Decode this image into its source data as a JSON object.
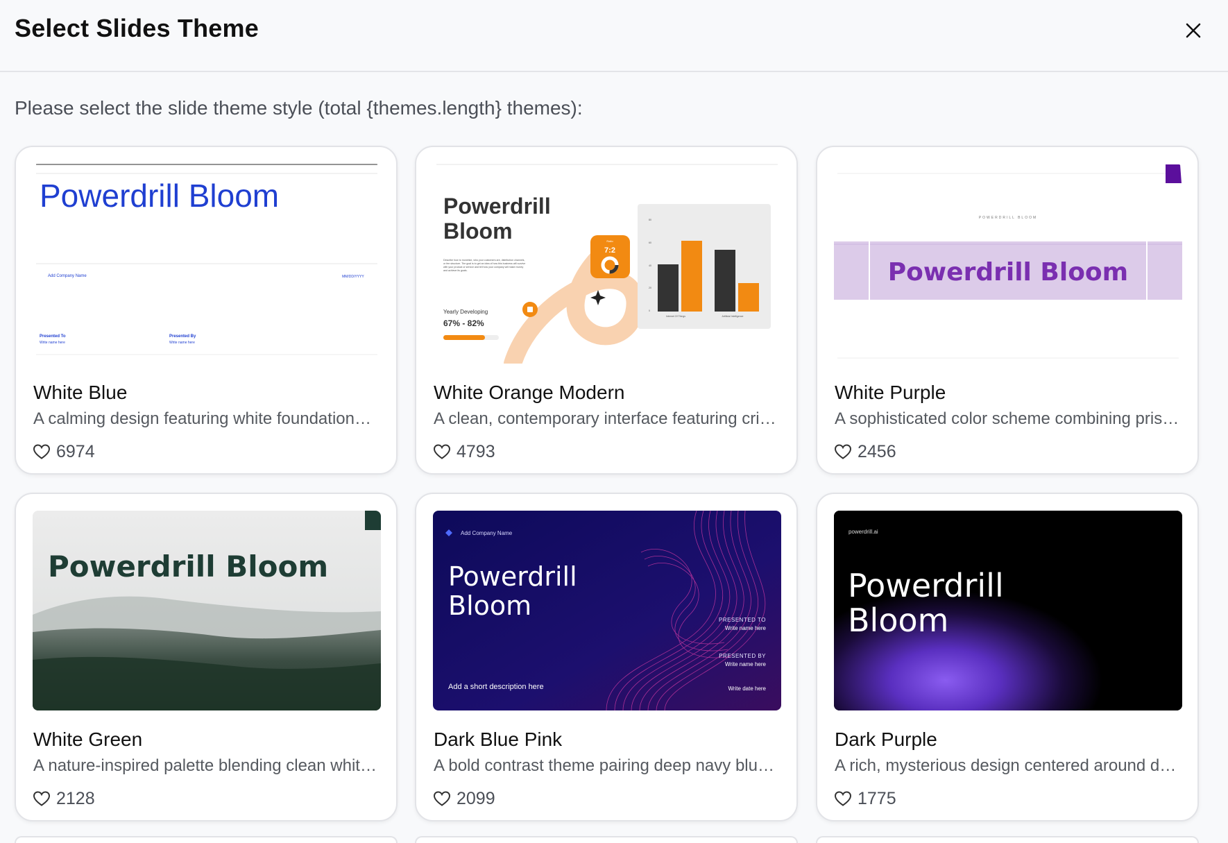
{
  "dialog": {
    "title": "Select Slides Theme",
    "subtitle": "Please select the slide theme style (total {themes.length} themes):"
  },
  "themes": [
    {
      "title": "White Blue",
      "description": "A calming design featuring white foundation…",
      "likes": "6974"
    },
    {
      "title": "White Orange Modern",
      "description": "A clean, contemporary interface featuring cri…",
      "likes": "4793"
    },
    {
      "title": "White Purple",
      "description": "A sophisticated color scheme combining pris…",
      "likes": "2456"
    },
    {
      "title": "White Green",
      "description": "A nature-inspired palette blending clean whit…",
      "likes": "2128"
    },
    {
      "title": "Dark Blue Pink",
      "description": "A bold contrast theme pairing deep navy blu…",
      "likes": "2099"
    },
    {
      "title": "Dark Purple",
      "description": "A rich, mysterious design centered around de…",
      "likes": "1775"
    }
  ],
  "thumbs": {
    "white_blue": {
      "title": "Powerdrill Bloom",
      "company": "Add Company Name",
      "date": "MM/DD/YYYY",
      "presented_to": "Presented To",
      "presented_by": "Presented By",
      "write_name": "Write name here"
    },
    "white_orange": {
      "title_1": "Powerdrill",
      "title_2": "Bloom",
      "body_1": "Describe how to monetize, who your customers are, distribution channels,",
      "body_2": "or fee structure. The goal is to get an idea of how this business will survive",
      "body_3": "with your product or service and tell how your company will make money",
      "body_4": "and achieve its goals.",
      "stat_label": "Yearly Developing",
      "stat_value": "67% - 82%",
      "ratio_label": "Ratio",
      "ratio": "7:2",
      "y_ticks": [
        "80",
        "60",
        "40",
        "20",
        "0"
      ],
      "cat_1": "Internet Of Things",
      "cat_2": "Artificial Intelligence"
    },
    "white_purple": {
      "kicker": "POWERDRILL BLOOM",
      "title": "Powerdrill Bloom"
    },
    "white_green": {
      "title": "Powerdrill Bloom"
    },
    "dark_blue_pink": {
      "company": "Add Company Name",
      "title_1": "Powerdrill",
      "title_2": "Bloom",
      "presented_to": "PRESENTED TO",
      "presented_by": "PRESENTED BY",
      "write_name": "Write name here",
      "description": "Add a short description here",
      "date": "Write date here"
    },
    "dark_purple": {
      "brand": "powerdrill.ai",
      "title_1": "Powerdrill",
      "title_2": "Bloom"
    }
  },
  "colors": {
    "blue": "#1f3fd1",
    "orange": "#f28a12",
    "purple": "#7a2fb0",
    "lilac": "#dccbe9",
    "green": "#1e3d34",
    "navy": "#140c5c"
  }
}
